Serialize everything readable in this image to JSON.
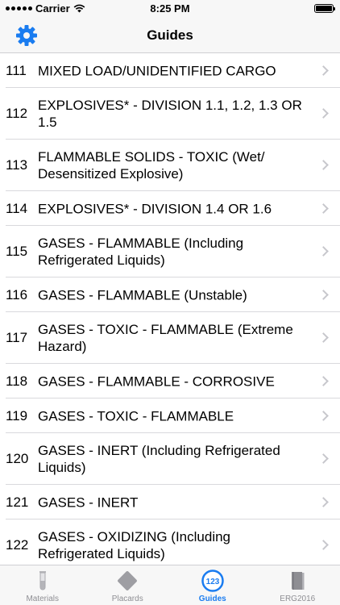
{
  "status_bar": {
    "carrier": "Carrier",
    "time": "8:25 PM"
  },
  "nav": {
    "title": "Guides"
  },
  "guides": [
    {
      "number": "111",
      "title": "MIXED LOAD/UNIDENTIFIED CARGO"
    },
    {
      "number": "112",
      "title": "EXPLOSIVES* - DIVISION 1.1, 1.2, 1.3 OR 1.5"
    },
    {
      "number": "113",
      "title": "FLAMMABLE SOLIDS - TOXIC (Wet/ Desensitized Explosive)"
    },
    {
      "number": "114",
      "title": "EXPLOSIVES* - DIVISION 1.4 OR 1.6"
    },
    {
      "number": "115",
      "title": "GASES - FLAMMABLE (Including Refrigerated Liquids)"
    },
    {
      "number": "116",
      "title": "GASES - FLAMMABLE (Unstable)"
    },
    {
      "number": "117",
      "title": "GASES - TOXIC - FLAMMABLE (Extreme Hazard)"
    },
    {
      "number": "118",
      "title": "GASES - FLAMMABLE - CORROSIVE"
    },
    {
      "number": "119",
      "title": "GASES - TOXIC - FLAMMABLE"
    },
    {
      "number": "120",
      "title": "GASES - INERT (Including Refrigerated Liquids)"
    },
    {
      "number": "121",
      "title": "GASES - INERT"
    },
    {
      "number": "122",
      "title": "GASES - OXIDIZING (Including Refrigerated Liquids)"
    }
  ],
  "tabs": [
    {
      "label": "Materials",
      "icon": "test-tube-icon",
      "active": false
    },
    {
      "label": "Placards",
      "icon": "placard-diamond-icon",
      "active": false
    },
    {
      "label": "Guides",
      "icon": "numbers-123-icon",
      "active": true
    },
    {
      "label": "ERG2016",
      "icon": "book-icon",
      "active": false
    }
  ],
  "colors": {
    "accent": "#1a7cf0",
    "inactive_tab": "#8e8e93",
    "separator": "#d9d9dd",
    "chevron": "#c7c7cc"
  }
}
